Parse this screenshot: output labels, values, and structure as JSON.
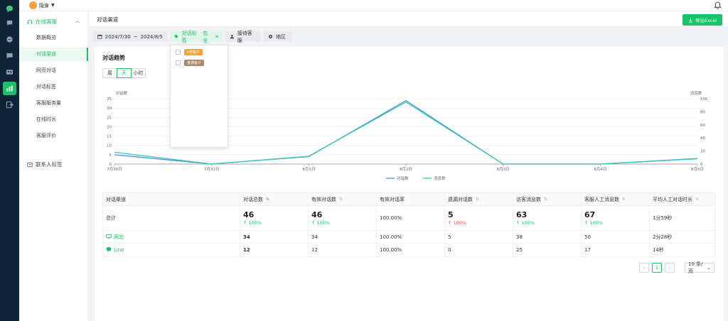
{
  "rail": {
    "icons": [
      "chat-bubble-icon",
      "message-icon",
      "comment-icon",
      "feedback-icon",
      "contact-card-icon",
      "bar-chart-icon",
      "export-icon"
    ],
    "active_index": 5,
    "accent": "#1fbf6a"
  },
  "topbar": {
    "brand": "隐身"
  },
  "menu": {
    "group": "在线客服",
    "items": [
      "数据概览",
      "对话渠道",
      "网页对话",
      "对话标签",
      "客服服务量",
      "在线时长",
      "客服评价"
    ],
    "active_index": 1,
    "group2": "联系人标签"
  },
  "page": {
    "title": "对话渠道",
    "export_label": "导出Excel"
  },
  "filters": {
    "date_start": "2024/7/30",
    "date_sep": "~",
    "date_end": "2024/8/5",
    "tag_label": "对话标签",
    "tag_mode": "包含",
    "agent_placeholder": "接待客服",
    "region_placeholder": "地区"
  },
  "dropdown": {
    "options": [
      {
        "label": "VIP客户",
        "color": "#f3a33b"
      },
      {
        "label": "普通客户",
        "color": "#a88a70"
      }
    ]
  },
  "trend": {
    "title": "对话趋势",
    "granularity": [
      "周",
      "天",
      "小时"
    ],
    "active": "天"
  },
  "chart_data": {
    "type": "line",
    "categories": [
      "7月30日",
      "7月31日",
      "8月1日",
      "8月2日",
      "8月3日",
      "8月4日",
      "8月5日"
    ],
    "y_left": {
      "label": "对话数",
      "ylim": [
        0,
        35
      ],
      "ticks": [
        0,
        5,
        10,
        15,
        20,
        25,
        30,
        35
      ]
    },
    "y_right": {
      "label": "消息数",
      "ylim": [
        0,
        100
      ],
      "ticks": [
        0,
        20,
        40,
        60,
        80,
        100
      ]
    },
    "series": [
      {
        "name": "对话数",
        "axis": "left",
        "color": "#4a90d9",
        "values": [
          5,
          0,
          4,
          34,
          0,
          0,
          3
        ]
      },
      {
        "name": "消息数",
        "axis": "right",
        "color": "#3cc7b2",
        "values": [
          18,
          0,
          12,
          95,
          0,
          0,
          8
        ]
      }
    ],
    "grid": true,
    "legend": "bottom"
  },
  "table": {
    "columns": [
      "对话渠道",
      "对话总数",
      "有效对话数",
      "有效对话率",
      "遗漏对话数",
      "访客消息数",
      "客服人工消息数",
      "平均人工对话时长"
    ],
    "sortable": [
      false,
      true,
      true,
      false,
      true,
      true,
      true,
      true
    ],
    "sort_active": 1,
    "total": {
      "label": "总计",
      "values": [
        "46",
        "46",
        "100.00%",
        "5",
        "63",
        "67",
        "1分59秒"
      ],
      "deltas": [
        "↑ 100%",
        "↑ 100%",
        "",
        "↑ 100%",
        "↑ 100%",
        "↑ 100%",
        ""
      ],
      "delta_red": [
        false,
        false,
        false,
        true,
        false,
        false,
        false
      ]
    },
    "rows": [
      {
        "channel": "网站",
        "icon": "monitor-icon",
        "values": [
          "34",
          "34",
          "100.00%",
          "5",
          "38",
          "50",
          "2分28秒"
        ]
      },
      {
        "channel": "Line",
        "icon": "line-app-icon",
        "values": [
          "12",
          "12",
          "100.00%",
          "0",
          "25",
          "17",
          "14秒"
        ]
      }
    ]
  },
  "pager": {
    "prev": "‹",
    "page": "1",
    "next": "›",
    "page_size": "10 条/页"
  }
}
